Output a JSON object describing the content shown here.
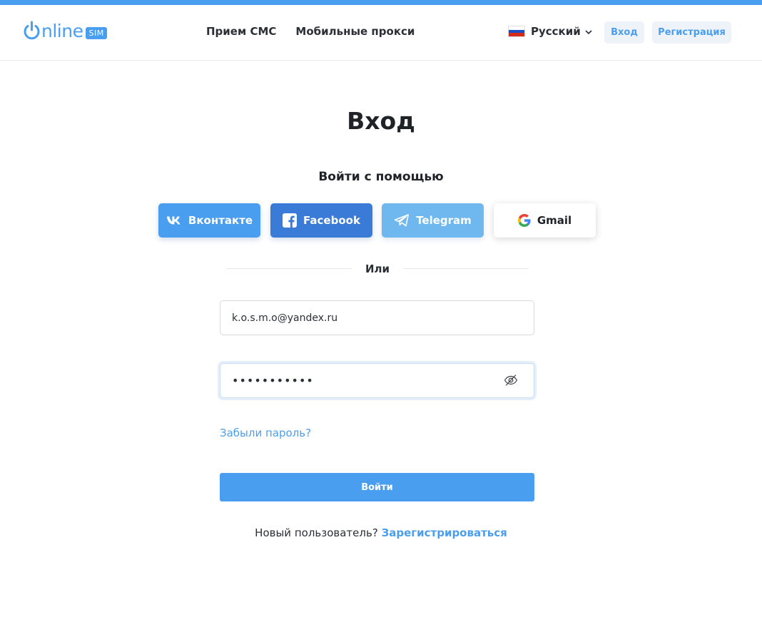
{
  "colors": {
    "accent": "#4a9ef0",
    "facebook": "#3b7bd8",
    "telegram": "#6fb8ef",
    "text": "#1f2328"
  },
  "header": {
    "logo": {
      "word": "nline",
      "badge": "SIM"
    },
    "nav": [
      {
        "label": "Прием СМС"
      },
      {
        "label": "Мобильные прокси"
      }
    ],
    "language": {
      "label": "Русский",
      "flag_icon": "russia-flag-icon"
    },
    "login_label": "Вход",
    "register_label": "Регистрация"
  },
  "main": {
    "title": "Вход",
    "login_with": "Войти с помощью",
    "social": [
      {
        "label": "Вконтакте",
        "icon": "vk-icon"
      },
      {
        "label": "Facebook",
        "icon": "facebook-icon"
      },
      {
        "label": "Telegram",
        "icon": "telegram-icon"
      },
      {
        "label": "Gmail",
        "icon": "google-icon"
      }
    ],
    "or_label": "Или",
    "email_value": "k.o.s.m.o@yandex.ru",
    "password_value": "•••••••••••",
    "forgot_label": "Забыли пароль?",
    "submit_label": "Войти",
    "new_user_text": "Новый пользователь?",
    "register_link": "Зарегистрироваться"
  }
}
